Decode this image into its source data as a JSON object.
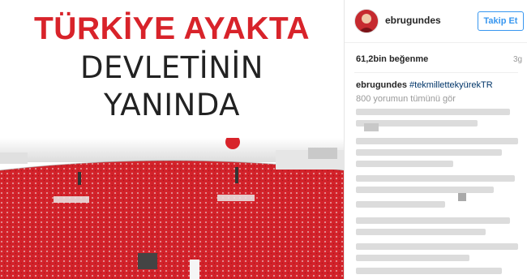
{
  "post": {
    "headline_line1": "TÜRKİYE AYAKTA",
    "headline_line2": "DEVLETİNİN",
    "headline_line3": "YANINDA"
  },
  "header": {
    "username": "ebrugundes",
    "follow_label": "Takip Et"
  },
  "stats": {
    "likes": "61,2bin beğenme",
    "time": "3g"
  },
  "caption": {
    "username": "ebrugundes",
    "hashtag": "#tekmillettekyürekTR"
  },
  "comments": {
    "view_all": "800 yorumun tümünü gör"
  },
  "colors": {
    "headline_red": "#d8232a",
    "follow_blue": "#3897f0",
    "hashtag_blue": "#003569",
    "crowd_red": "#d3222a"
  }
}
